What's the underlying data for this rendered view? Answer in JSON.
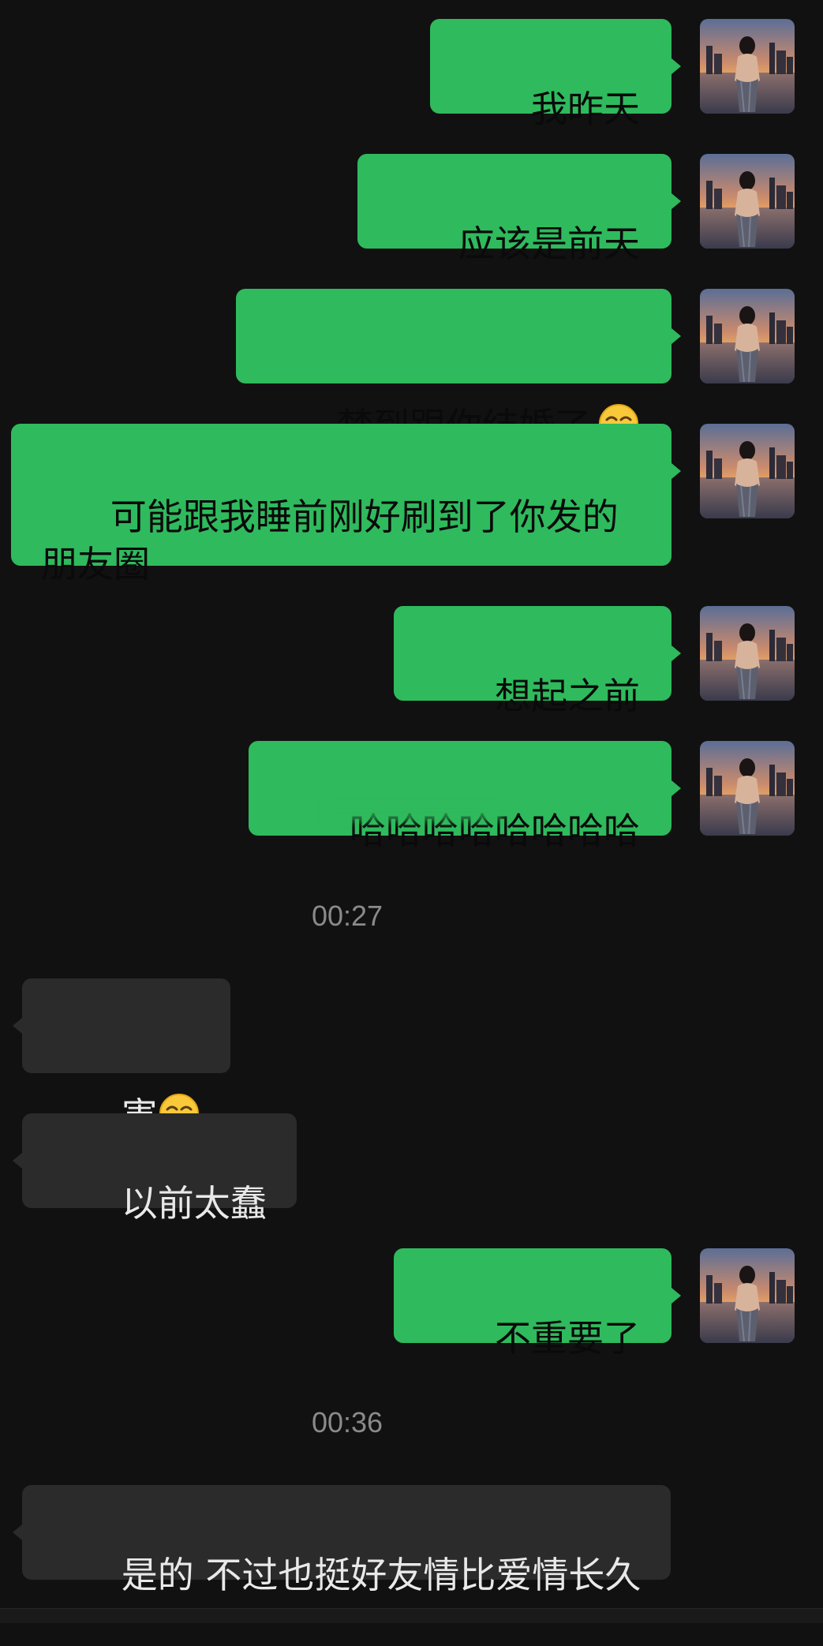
{
  "messages": [
    {
      "id": "m1",
      "text": "我昨天",
      "emoji": null
    },
    {
      "id": "m2",
      "text": "应该是前天",
      "emoji": null
    },
    {
      "id": "m3",
      "text": "梦到跟你结婚了",
      "emoji": "face-with-tears-of-joy"
    },
    {
      "id": "m4",
      "text": "可能跟我睡前刚好刷到了你发的朋友圈",
      "emoji": null
    },
    {
      "id": "m5",
      "text": "想起之前",
      "emoji": null
    },
    {
      "id": "m6",
      "text": "哈哈哈哈哈哈哈哈",
      "emoji": null
    },
    {
      "id": "m7",
      "text": "害",
      "emoji": "face-with-tears-of-joy"
    },
    {
      "id": "m8",
      "text": "以前太蠢",
      "emoji": null
    },
    {
      "id": "m9",
      "text": "不重要了",
      "emoji": null
    },
    {
      "id": "m10",
      "text": "是的 不过也挺好友情比爱情长久",
      "emoji": null
    }
  ],
  "timestamps": [
    "00:27",
    "00:36"
  ],
  "colors": {
    "background": "#111111",
    "outgoing_bubble": "#2fba5d",
    "incoming_bubble": "#2b2b2b",
    "timestamp_text": "#8a8a8a"
  },
  "icons": {
    "avatar": "avatar-photo",
    "emoji": "face-with-tears-of-joy-icon"
  }
}
